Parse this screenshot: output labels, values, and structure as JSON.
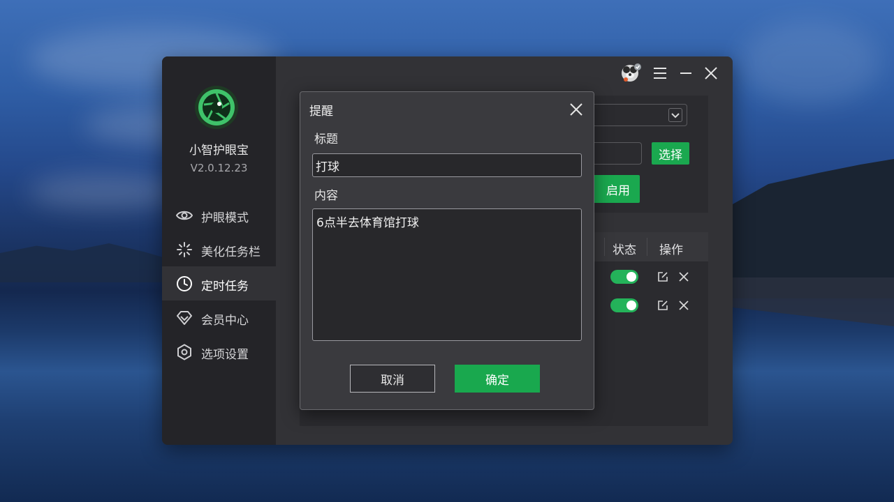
{
  "app": {
    "name": "小智护眼宝",
    "version": "V2.0.12.23"
  },
  "sidebar": {
    "items": [
      {
        "label": "护眼模式",
        "icon": "eye-icon"
      },
      {
        "label": "美化任务栏",
        "icon": "sparkle-icon"
      },
      {
        "label": "定时任务",
        "icon": "clock-icon",
        "active": true
      },
      {
        "label": "会员中心",
        "icon": "diamond-icon"
      },
      {
        "label": "选项设置",
        "icon": "hexagon-settings-icon"
      }
    ]
  },
  "main": {
    "select_button": "选择",
    "enable_button_partial": "启用",
    "table": {
      "headers": [
        "状态",
        "操作"
      ],
      "rows": [
        {
          "enabled": true
        },
        {
          "enabled": true
        }
      ]
    }
  },
  "dialog": {
    "title": "提醒",
    "title_label": "标题",
    "title_value": "打球",
    "content_label": "内容",
    "content_value": "6点半去体育馆打球",
    "cancel": "取消",
    "confirm": "确定"
  },
  "colors": {
    "accent": "#1aa84f",
    "sidebar_bg": "#242428",
    "window_bg": "#323236",
    "dialog_bg": "#3a3a3e"
  }
}
